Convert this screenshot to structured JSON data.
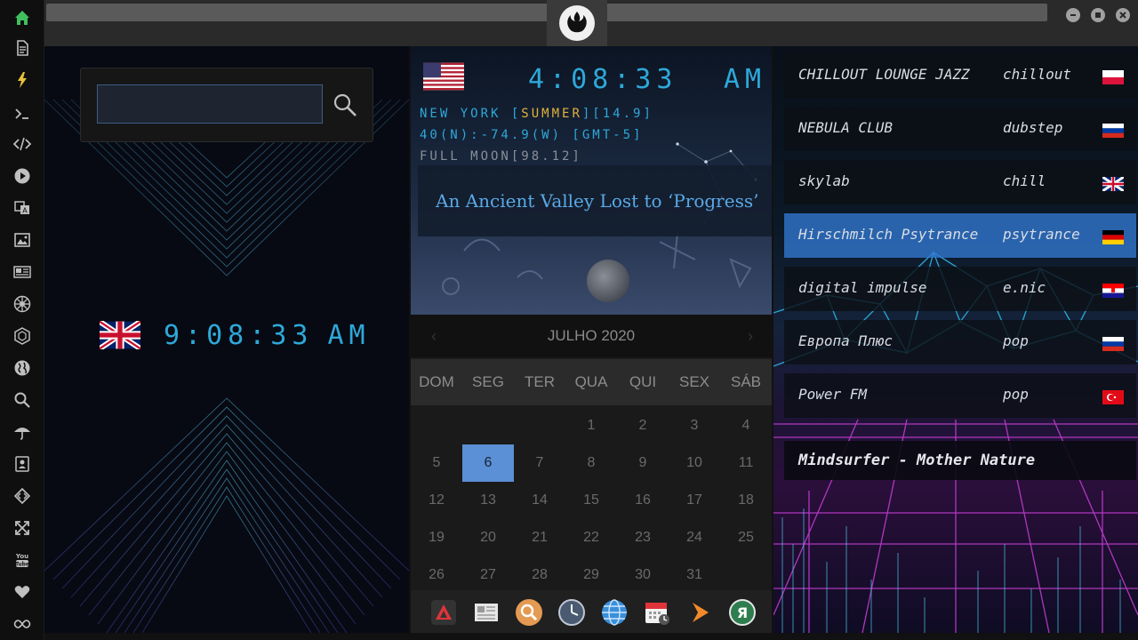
{
  "sidebar": {
    "items": [
      {
        "name": "home-icon",
        "color": "#3fbf5f"
      },
      {
        "name": "document-icon",
        "color": "#bfbfbf"
      },
      {
        "name": "lightning-icon",
        "color": "#e6c13a"
      },
      {
        "name": "terminal-icon",
        "color": "#bfbfbf"
      },
      {
        "name": "code-icon",
        "color": "#bfbfbf"
      },
      {
        "name": "play-icon",
        "color": "#bfbfbf"
      },
      {
        "name": "translate-icon",
        "color": "#bfbfbf"
      },
      {
        "name": "image-icon",
        "color": "#bfbfbf"
      },
      {
        "name": "news-icon",
        "color": "#bfbfbf"
      },
      {
        "name": "empire-icon",
        "color": "#bfbfbf"
      },
      {
        "name": "hexagon-icon",
        "color": "#bfbfbf"
      },
      {
        "name": "globe-icon",
        "color": "#bfbfbf"
      },
      {
        "name": "search-icon",
        "color": "#bfbfbf"
      },
      {
        "name": "umbrella-icon",
        "color": "#bfbfbf"
      },
      {
        "name": "contacts-icon",
        "color": "#bfbfbf"
      },
      {
        "name": "dev-icon",
        "color": "#bfbfbf"
      },
      {
        "name": "expand-icon",
        "color": "#bfbfbf"
      },
      {
        "name": "youtube-icon",
        "color": "#bfbfbf",
        "label": "You Tube"
      },
      {
        "name": "heart-icon",
        "color": "#bfbfbf"
      },
      {
        "name": "infinity-icon",
        "color": "#bfbfbf"
      }
    ]
  },
  "topbar": {
    "logo": "rebel-alliance-icon",
    "controls": [
      "minimize-icon",
      "maximize-icon",
      "close-icon"
    ]
  },
  "left_panel": {
    "search": {
      "value": "",
      "placeholder": ""
    },
    "uk_clock": {
      "flag": "uk-flag",
      "time": "9:08:33",
      "ampm": "AM"
    }
  },
  "mid_panel": {
    "ny_clock": {
      "flag": "us-flag",
      "time": "4:08:33",
      "ampm": "AM"
    },
    "location_prefix": "NEW YORK [",
    "location_highlight": "SUMMER",
    "location_suffix": "][14.9]",
    "coords": "40(N):-74.9(W) [GMT-5]",
    "moon": "FULL MOON[98.12]",
    "headline": "An Ancient Valley Lost to ‘Progress’"
  },
  "calendar": {
    "month_label": "JULHO 2020",
    "weekdays": [
      "DOM",
      "SEG",
      "TER",
      "QUA",
      "QUI",
      "SEX",
      "SÁB"
    ],
    "today": "6",
    "weeks": [
      [
        "",
        "",
        "",
        "1",
        "2",
        "3",
        "4"
      ],
      [
        "5",
        "6",
        "7",
        "8",
        "9",
        "10",
        "11"
      ],
      [
        "12",
        "13",
        "14",
        "15",
        "16",
        "17",
        "18"
      ],
      [
        "19",
        "20",
        "21",
        "22",
        "23",
        "24",
        "25"
      ],
      [
        "26",
        "27",
        "28",
        "29",
        "30",
        "31",
        ""
      ]
    ]
  },
  "dock": {
    "apps": [
      "anydesk-icon",
      "newspaper-icon",
      "search-app-icon",
      "clock-icon",
      "globe-app-icon",
      "calendar-icon",
      "play-arrow-icon",
      "yandex-icon"
    ]
  },
  "radio": {
    "stations": [
      {
        "name": "CHILLOUT LOUNGE JAZZ",
        "genre": "chillout",
        "flag": "poland-flag"
      },
      {
        "name": "NEBULA CLUB",
        "genre": "dubstep",
        "flag": "russia-flag"
      },
      {
        "name": "skylab",
        "genre": "chill",
        "flag": "uk-flag"
      },
      {
        "name": "Hirschmilch Psytrance",
        "genre": "psytrance",
        "flag": "germany-flag"
      },
      {
        "name": "digital impulse",
        "genre": "e.nic",
        "flag": "croatia-flag"
      },
      {
        "name": "Европа Плюс",
        "genre": "pop",
        "flag": "russia-flag"
      },
      {
        "name": "Power FM",
        "genre": "pop",
        "flag": "turkey-flag"
      }
    ],
    "active_index": 3,
    "now_playing": "Mindsurfer - Mother Nature"
  }
}
